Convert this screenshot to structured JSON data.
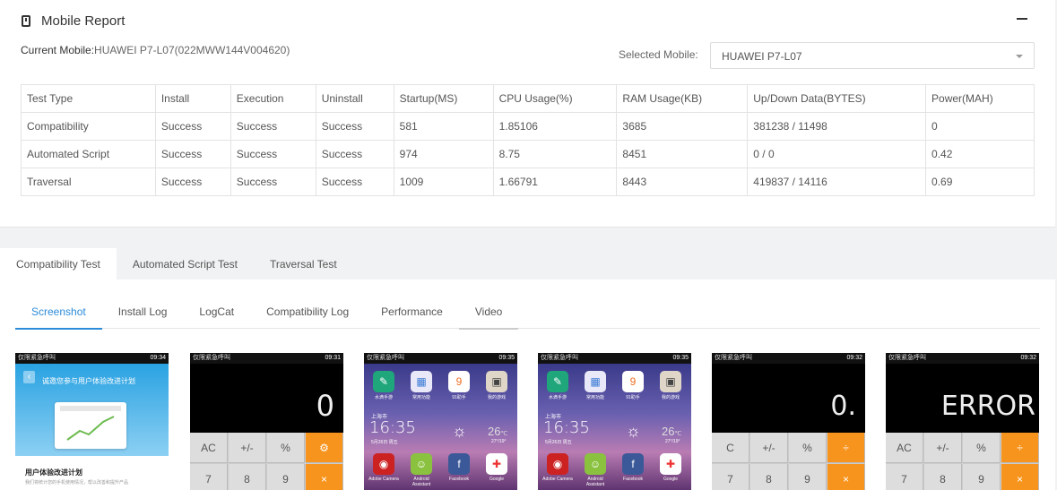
{
  "report": {
    "title": "Mobile Report",
    "current_mobile_label": "Current Mobile:",
    "current_mobile_value": "HUAWEI P7-L07(022MWW144V004620)",
    "selected_mobile_label": "Selected Mobile:",
    "selected_mobile_value": "HUAWEI P7-L07",
    "headers": [
      "Test Type",
      "Install",
      "Execution",
      "Uninstall",
      "Startup(MS)",
      "CPU Usage(%)",
      "RAM Usage(KB)",
      "Up/Down Data(BYTES)",
      "Power(MAH)"
    ],
    "rows": [
      [
        "Compatibility",
        "Success",
        "Success",
        "Success",
        "581",
        "1.85106",
        "3685",
        "381238 / 11498",
        "0"
      ],
      [
        "Automated Script",
        "Success",
        "Success",
        "Success",
        "974",
        "8.75",
        "8451",
        "0 / 0",
        "0.42"
      ],
      [
        "Traversal",
        "Success",
        "Success",
        "Success",
        "1009",
        "1.66791",
        "8443",
        "419837 / 14116",
        "0.69"
      ]
    ]
  },
  "tabs": [
    "Compatibility Test",
    "Automated Script Test",
    "Traversal Test"
  ],
  "subtabs": [
    "Screenshot",
    "Install Log",
    "LogCat",
    "Compatibility Log",
    "Performance",
    "Video"
  ],
  "screenshots": [
    {
      "status_left": "仅限紧急呼叫",
      "time": "09:34",
      "header": "诚邀您参与用户体验改进计划",
      "title": "用户体验改进计划",
      "subtitle": "我们将统计您的手机使用情况，帮以改善和提升产品"
    },
    {
      "status_left": "仅限紧急呼叫",
      "time": "09:31",
      "display": "0",
      "keys": [
        "AC",
        "+/-",
        "%",
        "",
        "7",
        "8",
        "9",
        "×"
      ]
    },
    {
      "status_left": "仅限紧急呼叫",
      "time": "09:35",
      "apps_top": [
        "水滴手游",
        "常用功能",
        "91助手",
        "我的游戏"
      ],
      "city": "上海市",
      "clock": "16:35",
      "date": "5月26日 周五",
      "temp": "26",
      "temp_unit": "℃",
      "temp_range": "27°/19°",
      "apps_bottom": [
        "Adobe Camera",
        "Android Assistant",
        "Facebook",
        "Google"
      ]
    },
    {
      "status_left": "仅限紧急呼叫",
      "time": "09:35",
      "apps_top": [
        "水滴手游",
        "常用功能",
        "91助手",
        "我的游戏"
      ],
      "city": "上海市",
      "clock": "16:35",
      "date": "5月26日 周五",
      "temp": "26",
      "temp_unit": "℃",
      "temp_range": "27°/19°",
      "apps_bottom": [
        "Adobe Camera",
        "Android Assistant",
        "Facebook",
        "Google"
      ]
    },
    {
      "status_left": "仅限紧急呼叫",
      "time": "09:32",
      "display": "0.",
      "keys": [
        "C",
        "+/-",
        "%",
        "÷",
        "7",
        "8",
        "9",
        "×"
      ]
    },
    {
      "status_left": "仅限紧急呼叫",
      "time": "09:32",
      "display": "ERROR",
      "keys": [
        "AC",
        "+/-",
        "%",
        "÷",
        "7",
        "8",
        "9",
        "×"
      ]
    }
  ],
  "colors": {
    "accent": "#2d8cd9",
    "calc_op": "#f7941d"
  }
}
